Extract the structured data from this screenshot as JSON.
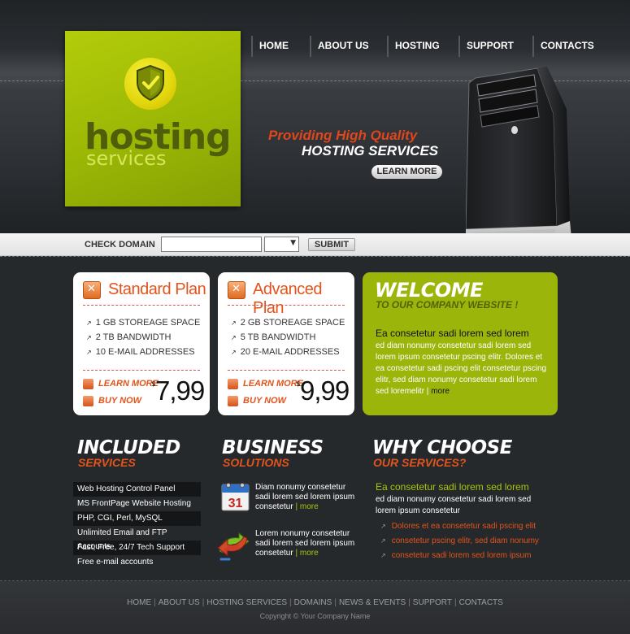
{
  "logo": {
    "title": "hosting",
    "subtitle": "services",
    "icon": "shield-check-icon"
  },
  "nav": {
    "items": [
      "HOME",
      "ABOUT US",
      "HOSTING",
      "SUPPORT",
      "CONTACTS"
    ]
  },
  "promo": {
    "line1": "Providing High Quality",
    "line2": "HOSTING SERVICES",
    "button": "LEARN MORE"
  },
  "domain": {
    "label": "CHECK DOMAIN",
    "input_value": "",
    "select_value": "",
    "submit": "SUBMIT"
  },
  "plans": [
    {
      "name": "Standard Plan",
      "features": [
        "1 GB STOREAGE SPACE",
        "2 TB BANDWIDTH",
        "10 E-MAIL ADDRESSES"
      ],
      "learn_more": "LEARN MORE",
      "buy_now": "BUY NOW",
      "currency": "$",
      "price": "7,99"
    },
    {
      "name": "Advanced Plan",
      "features": [
        "2 GB STOREAGE SPACE",
        "5 TB BANDWIDTH",
        "20 E-MAIL ADDRESSES"
      ],
      "learn_more": "LEARN MORE",
      "buy_now": "BUY NOW",
      "currency": "$",
      "price": "9,99"
    }
  ],
  "welcome": {
    "title": "WELCOME",
    "subtitle": "TO OUR COMPANY WEBSITE !",
    "lead": "Ea consetetur sadi lorem sed lorem",
    "body": "ed diam nonumy consetetur sadi lorem sed lorem ipsum consetetur pscing elitr. Dolores et ea consetetur sadi pscing elit consetetur pscing elitr, sed diam nonumy consetetur sadi lorem sed loremelitr",
    "separator": " | ",
    "more": "more"
  },
  "included": {
    "title": "INCLUDED",
    "subtitle": "SERVICES",
    "items": [
      "Web Hosting Control Panel",
      "MS FrontPage Website Hosting",
      "PHP, CGI, Perl, MySQL",
      "Unlimited Email and FTP Accounts",
      "Fast, Free, 24/7 Tech Support",
      "Free e-mail accounts"
    ]
  },
  "business": {
    "title": "BUSINESS",
    "subtitle": "SOLUTIONS",
    "items": [
      {
        "icon": "calendar-icon",
        "calendar_day": "31",
        "text": "Diam nonumy consetetur sadi lorem sed lorem ipsum consetetur",
        "more": "more"
      },
      {
        "icon": "arrows-exchange-icon",
        "text": "Lorem nonumy consetetur sadi lorem sed lorem ipsum consetetur",
        "more": "more"
      }
    ]
  },
  "why": {
    "title": "WHY CHOOSE",
    "subtitle": "OUR SERVICES?",
    "lead": "Ea consetetur sadi lorem sed lorem",
    "body": "ed diam nonumy consetetur sadi lorem sed lorem ipsum consetetur",
    "items": [
      "Dolores et ea consetetur sadi pscing elit",
      "consetetur pscing elitr, sed diam nonumy",
      "consetetur sadi lorem sed lorem ipsum"
    ]
  },
  "footer": {
    "links": [
      "HOME",
      "ABOUT US",
      "HOSTING SERVICES",
      "DOMAINS",
      "NEWS & EVENTS",
      "SUPPORT",
      "CONTACTS"
    ],
    "copyright": "Copyright © Your Company Name"
  },
  "colors": {
    "accent_green": "#9cb50a",
    "accent_orange": "#e2541c",
    "background": "#26292c"
  }
}
